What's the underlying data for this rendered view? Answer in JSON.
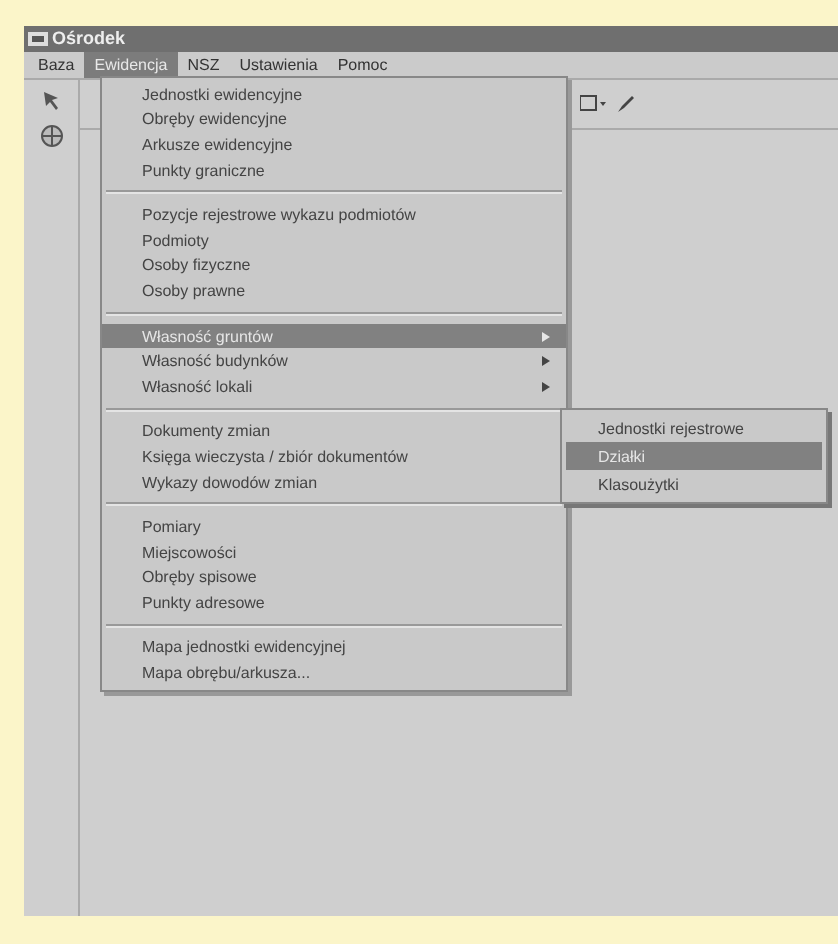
{
  "window": {
    "title": "Ośrodek"
  },
  "menubar": [
    {
      "label": "Baza",
      "selected": false
    },
    {
      "label": "Ewidencja",
      "selected": true
    },
    {
      "label": "NSZ",
      "selected": false
    },
    {
      "label": "Ustawienia",
      "selected": false
    },
    {
      "label": "Pomoc",
      "selected": false
    }
  ],
  "menu": {
    "groups": [
      [
        {
          "label": "Jednostki ewidencyjne",
          "selected": false,
          "submenu": false
        },
        {
          "label": "Obręby ewidencyjne",
          "selected": false,
          "submenu": false
        },
        {
          "label": "Arkusze ewidencyjne",
          "selected": false,
          "submenu": false
        },
        {
          "label": "Punkty graniczne",
          "selected": false,
          "submenu": false
        }
      ],
      [
        {
          "label": "Pozycje rejestrowe wykazu podmiotów",
          "selected": false,
          "submenu": false
        },
        {
          "label": "Podmioty",
          "selected": false,
          "submenu": false
        },
        {
          "label": "Osoby fizyczne",
          "selected": false,
          "submenu": false
        },
        {
          "label": "Osoby prawne",
          "selected": false,
          "submenu": false
        }
      ],
      [
        {
          "label": "Własność gruntów",
          "selected": true,
          "submenu": true
        },
        {
          "label": "Własność budynków",
          "selected": false,
          "submenu": true
        },
        {
          "label": "Własność lokali",
          "selected": false,
          "submenu": true
        }
      ],
      [
        {
          "label": "Dokumenty zmian",
          "selected": false,
          "submenu": false
        },
        {
          "label": "Księga wieczysta / zbiór dokumentów",
          "selected": false,
          "submenu": false
        },
        {
          "label": "Wykazy dowodów zmian",
          "selected": false,
          "submenu": false
        }
      ],
      [
        {
          "label": "Pomiary",
          "selected": false,
          "submenu": false
        },
        {
          "label": "Miejscowości",
          "selected": false,
          "submenu": false
        },
        {
          "label": "Obręby spisowe",
          "selected": false,
          "submenu": false
        },
        {
          "label": "Punkty adresowe",
          "selected": false,
          "submenu": false
        }
      ],
      [
        {
          "label": "Mapa jednostki ewidencyjnej",
          "selected": false,
          "submenu": false
        },
        {
          "label": "Mapa obrębu/arkusza...",
          "selected": false,
          "submenu": false
        }
      ]
    ]
  },
  "submenu": [
    {
      "label": "Jednostki rejestrowe",
      "selected": false
    },
    {
      "label": "Działki",
      "selected": true
    },
    {
      "label": "Klasoużytki",
      "selected": false
    }
  ]
}
